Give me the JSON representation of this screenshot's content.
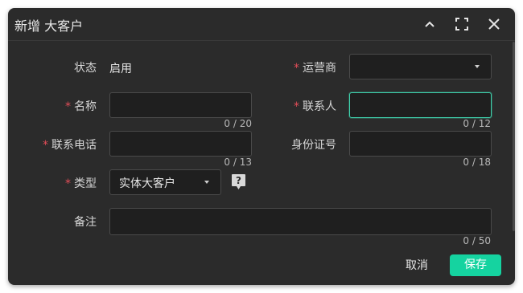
{
  "dialog": {
    "title": "新增 大客户",
    "collapse_icon": "chevron-up-icon",
    "fullscreen_icon": "fullscreen-icon",
    "close_icon": "close-icon"
  },
  "form": {
    "required_mark": "*",
    "status": {
      "label": "状态",
      "value": "启用"
    },
    "operator": {
      "label": "运营商",
      "value": ""
    },
    "name": {
      "label": "名称",
      "value": "",
      "counter": "0 / 20"
    },
    "contact": {
      "label": "联系人",
      "value": "",
      "counter": "0 / 12"
    },
    "phone": {
      "label": "联系电话",
      "value": "",
      "counter": "0 / 13"
    },
    "id_number": {
      "label": "身份证号",
      "value": "",
      "counter": "0 / 18"
    },
    "type": {
      "label": "类型",
      "value": "实体大客户",
      "help_icon": "help-icon"
    },
    "remark": {
      "label": "备注",
      "value": "",
      "counter": "0 / 50"
    }
  },
  "footer": {
    "cancel_label": "取消",
    "save_label": "保存"
  },
  "colors": {
    "background": "#2b2b2b",
    "input_background": "#1f1f1f",
    "accent": "#15d3a0",
    "focus_border": "#3fd2ad",
    "required": "#e34d59"
  }
}
